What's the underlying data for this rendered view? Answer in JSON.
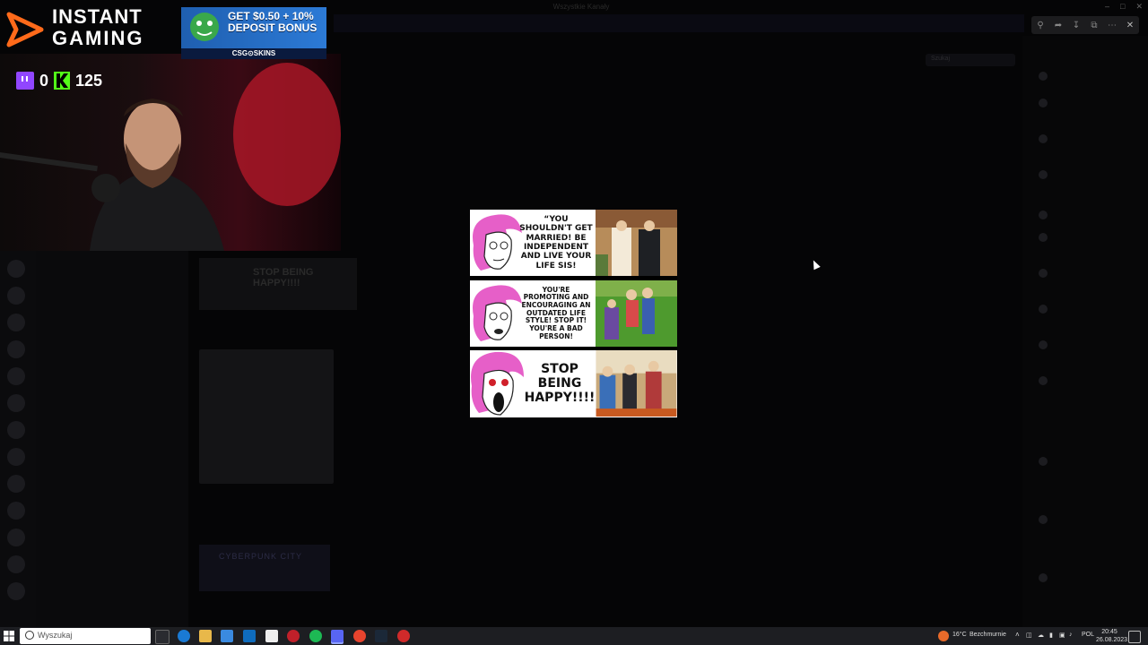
{
  "window": {
    "title": "Wszystkie Kanały"
  },
  "viewer_tools": [
    "zoom-in-icon",
    "share-icon",
    "download-icon",
    "open-external-icon",
    "more-icon",
    "close-icon"
  ],
  "overlay": {
    "logo_line1": "INSTANT",
    "logo_line2": "GAMING",
    "ad_title_line1": "GET $0.50 + 10%",
    "ad_title_line2": "DEPOSIT BONUS",
    "ad_brand": "CSG⊙SKINS",
    "twitch_count": "0",
    "kick_count": "125"
  },
  "background": {
    "chat_image_text": "STOP BEING HAPPY!!!!",
    "chat_image3_text": "CYBERPUNK CITY",
    "search_placeholder": "Szukaj"
  },
  "meme": {
    "panels": [
      {
        "text": "“YOU SHOULDN'T GET MARRIED! BE INDEPENDENT AND LIVE YOUR LIFE SIS!"
      },
      {
        "text": "YOU'RE PROMOTING AND ENCOURAGING AN OUTDATED LIFE STYLE! STOP IT! YOU'RE A BAD PERSON!"
      },
      {
        "text": "STOP BEING HAPPY!!!!"
      }
    ]
  },
  "taskbar": {
    "search_placeholder": "Wyszukaj",
    "weather_temp": "16°C",
    "weather_desc": "Bezchmurnie",
    "language": "POL",
    "time": "20:45",
    "date": "26.08.2023"
  },
  "colors": {
    "twitch": "#9146ff",
    "kick": "#53fc18",
    "pink_hair": "#e65fc8"
  }
}
